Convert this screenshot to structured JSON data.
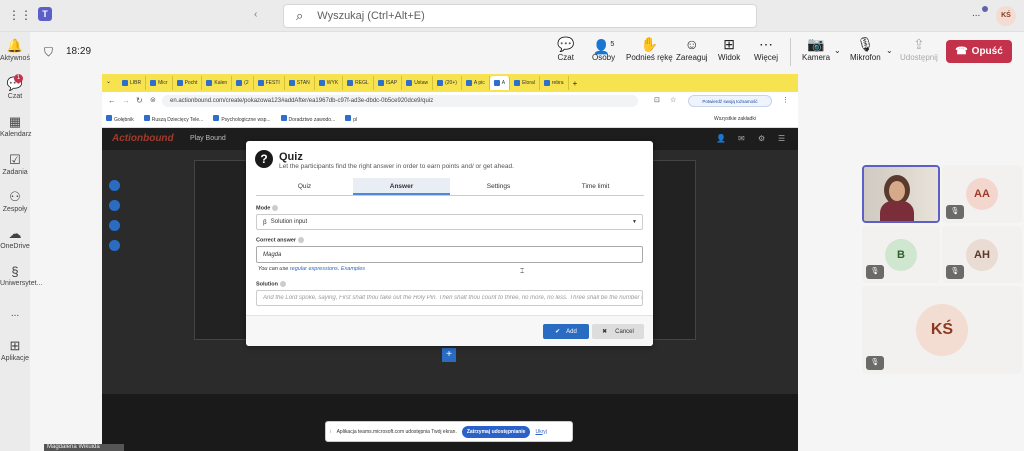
{
  "teams": {
    "search_placeholder": "Wyszukaj (Ctrl+Alt+E)",
    "user_initials": "KŚ",
    "more_label": "..."
  },
  "rail": [
    {
      "label": "Aktywność",
      "icon": "bell-icon"
    },
    {
      "label": "Czat",
      "icon": "chat-icon",
      "badge": "1"
    },
    {
      "label": "Kalendarz",
      "icon": "calendar-icon"
    },
    {
      "label": "Zadania",
      "icon": "tasks-icon"
    },
    {
      "label": "Zespoły",
      "icon": "teams-icon"
    },
    {
      "label": "OneDrive",
      "icon": "cloud-icon"
    },
    {
      "label": "Uniwersytet...",
      "icon": "app-icon"
    },
    {
      "label": "...",
      "icon": "more-icon"
    },
    {
      "label": "Aplikacje",
      "icon": "apps-icon"
    }
  ],
  "meeting": {
    "time": "18:29",
    "chat": "Czat",
    "people": "Osoby",
    "people_count": "5",
    "raise_hand": "Podnieś rękę",
    "react": "Zareaguj",
    "view": "Widok",
    "more": "Więcej",
    "camera": "Kamera",
    "mic": "Mikrofon",
    "share": "Udostępnij",
    "leave": "Opuść"
  },
  "browser": {
    "tabs": [
      "LIBR",
      "Micr",
      "Pocht",
      "Kalen",
      "(2",
      "FESTI",
      "STAN",
      "WYK",
      "REGL",
      "ISAP",
      "Ustaw",
      "(20+)",
      "A pic",
      "A",
      "Eloral",
      "rebra"
    ],
    "active_tab_index": 13,
    "url": "en.actionbound.com/create/pokazowa123#addAfter/ea1967db-c97f-ad3e-dbdc-0b5ce920dce9/quiz",
    "verify_label": "Potwierdź swoją tożsamość",
    "bookmarks": [
      "Gołębnik",
      "Ruszą Dziecięcy Tele...",
      "Psychologiczne wsp...",
      "Doradztwo zawodo...",
      "pl"
    ],
    "bookmarks_right": "Wszystkie zakładki"
  },
  "actionbound": {
    "logo": "Actionbound",
    "play_bound": "Play Bound"
  },
  "quiz": {
    "title": "Quiz",
    "subtitle": "Let the participants find the right answer in order to earn points and/ or get ahead.",
    "tabs": [
      "Quiz",
      "Answer",
      "Settings",
      "Time limit"
    ],
    "selected_tab": 1,
    "mode_label": "Mode",
    "mode_value": "Solution input",
    "correct_answer_label": "Correct answer",
    "correct_answer_value": "Magda",
    "hint_prefix": "You can use",
    "hint_link1": "regular expressions",
    "hint_link2": "Examples",
    "solution_label": "Solution",
    "solution_placeholder": "And the Lord spoke, saying, First shalt thou take out the Holy Pin. Then shalt thou count to three, no more, no less. Three shall be the number thou s",
    "add_label": "Add",
    "cancel_label": "Cancel"
  },
  "share_bar": {
    "text": "Aplikacja teams.microsoft.com udostępnia Twój ekran.",
    "stop_label": "Zatrzymaj udostępnianie",
    "hide_label": "Ukryj"
  },
  "participants": [
    {
      "initials": "AA",
      "muted": true,
      "color": "#f3d7cf",
      "text_color": "#9b3b2a"
    },
    {
      "initials": "B",
      "muted": true,
      "color": "#cfe6cf",
      "text_color": "#2f5e2f"
    },
    {
      "initials": "AH",
      "muted": true,
      "color": "#eadbd3",
      "text_color": "#5a3a2a"
    },
    {
      "initials": "KŚ",
      "muted": true,
      "color": "#f3dcd2",
      "text_color": "#8a3a22"
    }
  ],
  "bottom_name": "Magdalena Wikuida"
}
